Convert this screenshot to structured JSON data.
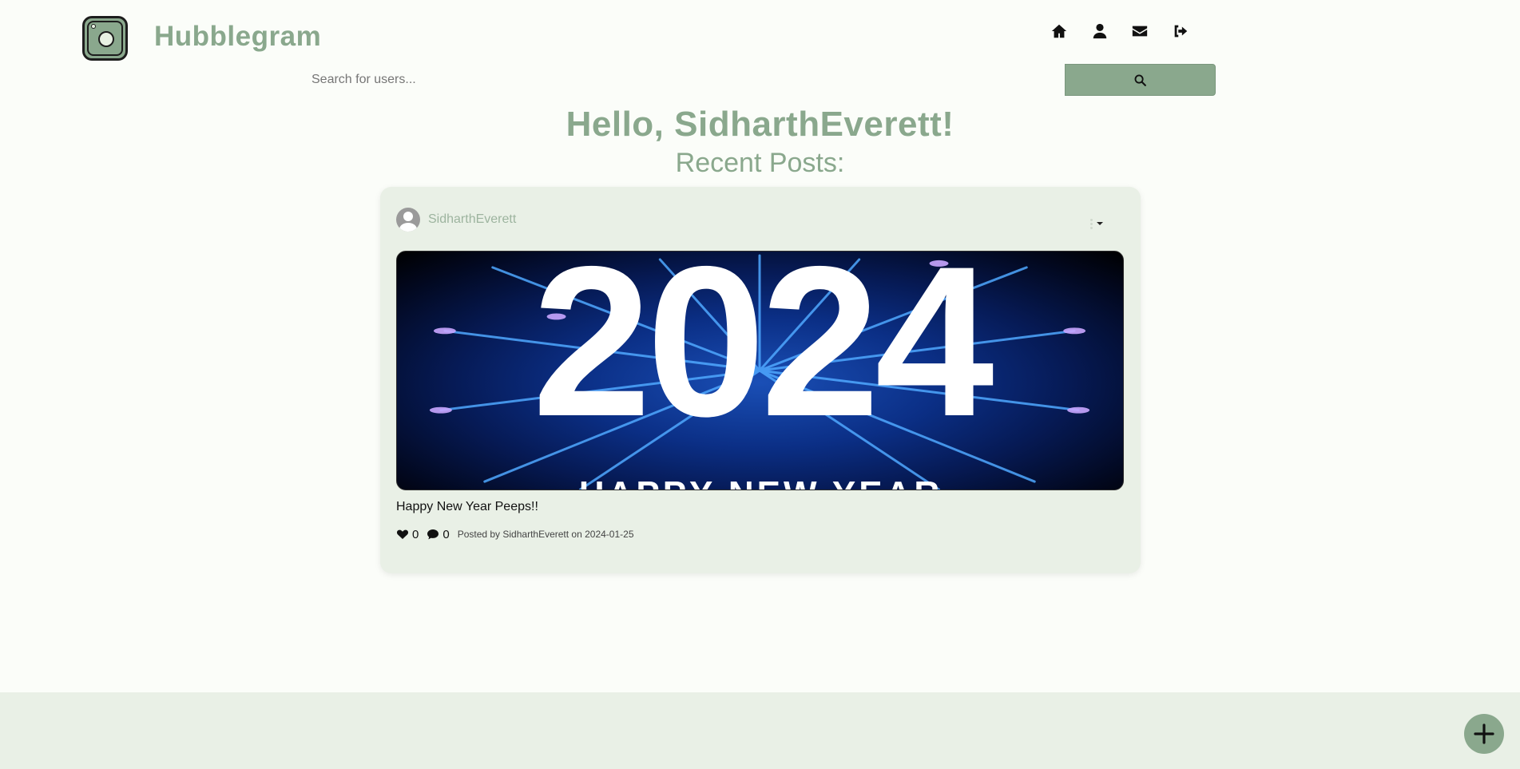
{
  "app": {
    "name": "Hubblegram",
    "accent_color": "#8aa88d"
  },
  "nav": {
    "icons": [
      "home-icon",
      "user-icon",
      "envelope-icon",
      "sign-out-icon"
    ]
  },
  "search": {
    "placeholder": "Search for users...",
    "value": "",
    "button_icon": "search-icon"
  },
  "greeting": "Hello, SidharthEverett!",
  "section_title": "Recent Posts:",
  "posts": [
    {
      "username": "SidharthEverett",
      "image_year": "2024",
      "image_banner": "HAPPY NEW YEAR",
      "caption": "Happy New Year Peeps!!",
      "likes": "0",
      "comments": "0",
      "posted_text": "Posted by SidharthEverett on 2024-01-25"
    }
  ],
  "fab_icon": "plus-icon"
}
